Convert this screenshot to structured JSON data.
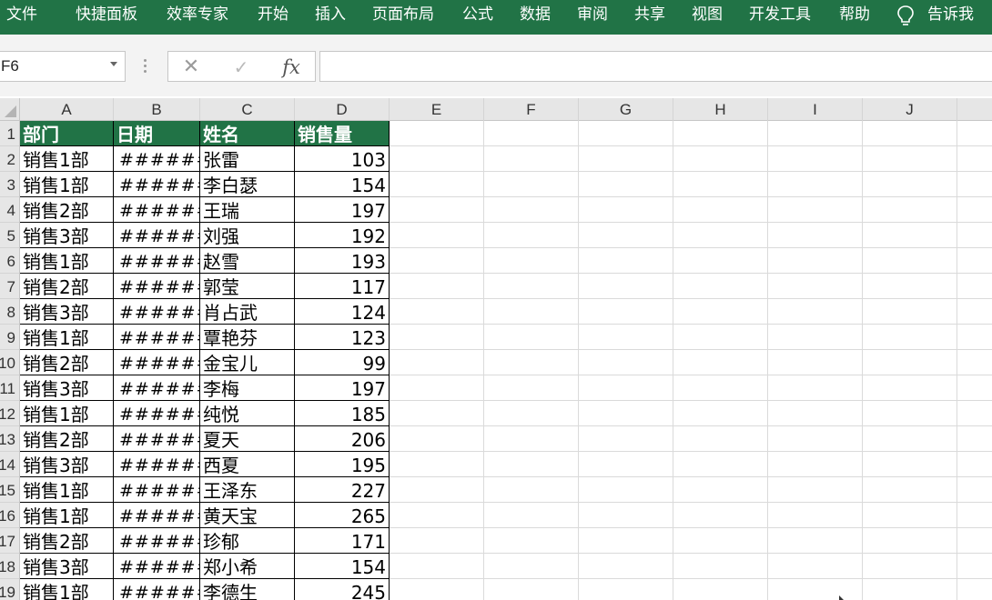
{
  "ribbon": {
    "tabs": [
      "文件",
      "快捷面板",
      "效率专家",
      "开始",
      "插入",
      "页面布局",
      "公式",
      "数据",
      "审阅",
      "共享",
      "视图",
      "开发工具",
      "帮助"
    ],
    "tell_me": "告诉我"
  },
  "formula_bar": {
    "name_box": "F6",
    "cancel_icon": "✕",
    "enter_icon": "✓",
    "function_icon": "fx",
    "formula": ""
  },
  "grid": {
    "columns": [
      "A",
      "B",
      "C",
      "D",
      "E",
      "F",
      "G",
      "H",
      "I",
      "J"
    ],
    "row_numbers": [
      "1",
      "2",
      "3",
      "4",
      "5",
      "6",
      "7",
      "8",
      "9",
      "10",
      "11",
      "12",
      "13",
      "14",
      "15",
      "16",
      "17",
      "18",
      "19"
    ],
    "header_row": [
      "部门",
      "日期",
      "姓名",
      "销售量"
    ],
    "rows": [
      [
        "销售1部",
        "######",
        "张雷",
        "103"
      ],
      [
        "销售1部",
        "######",
        "李白瑟",
        "154"
      ],
      [
        "销售2部",
        "######",
        "王瑞",
        "197"
      ],
      [
        "销售3部",
        "######",
        "刘强",
        "192"
      ],
      [
        "销售1部",
        "######",
        "赵雪",
        "193"
      ],
      [
        "销售2部",
        "######",
        "郭莹",
        "117"
      ],
      [
        "销售3部",
        "######",
        "肖占武",
        "124"
      ],
      [
        "销售1部",
        "######",
        "覃艳芬",
        "123"
      ],
      [
        "销售2部",
        "######",
        "金宝儿",
        "99"
      ],
      [
        "销售3部",
        "######",
        "李梅",
        "197"
      ],
      [
        "销售1部",
        "######",
        "纯悦",
        "185"
      ],
      [
        "销售2部",
        "######",
        "夏天",
        "206"
      ],
      [
        "销售3部",
        "######",
        "西夏",
        "195"
      ],
      [
        "销售1部",
        "######",
        "王泽东",
        "227"
      ],
      [
        "销售1部",
        "######",
        "黄天宝",
        "265"
      ],
      [
        "销售2部",
        "######",
        "珍郁",
        "171"
      ],
      [
        "销售3部",
        "######",
        "郑小希",
        "154"
      ],
      [
        "销售1部",
        "######",
        "李德生",
        "245"
      ]
    ]
  },
  "colors": {
    "accent": "#217346",
    "header_bg": "#e6e6e6",
    "gridline": "#dadada"
  }
}
